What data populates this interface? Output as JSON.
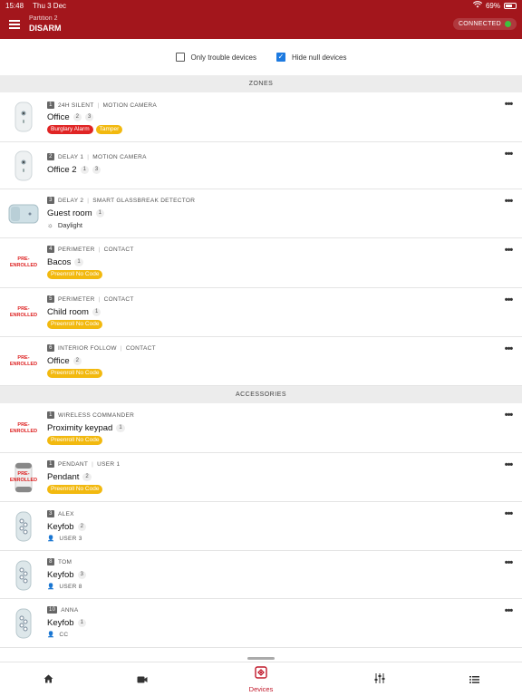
{
  "status_bar": {
    "time": "15:48",
    "date": "Thu 3 Dec",
    "battery": "69%"
  },
  "header": {
    "partition": "Partition 2",
    "state": "DISARM",
    "connection": "CONNECTED"
  },
  "filters": {
    "only_trouble": {
      "label": "Only trouble devices",
      "checked": false
    },
    "hide_null": {
      "label": "Hide null devices",
      "checked": true
    }
  },
  "sections": {
    "zones": "ZONES",
    "accessories": "ACCESSORIES"
  },
  "zones": [
    {
      "num": "1",
      "type": "24H SILENT",
      "model": "MOTION CAMERA",
      "name": "Office",
      "pills": [
        "2",
        "3"
      ],
      "tags": [
        "Burglary Alarm",
        "Tamper"
      ],
      "sub": ""
    },
    {
      "num": "2",
      "type": "DELAY 1",
      "model": "MOTION CAMERA",
      "name": "Office 2",
      "pills": [
        "1",
        "3"
      ],
      "tags": [],
      "sub": ""
    },
    {
      "num": "3",
      "type": "DELAY 2",
      "model": "SMART GLASSBREAK DETECTOR",
      "name": "Guest room",
      "pills": [
        "1"
      ],
      "tags": [],
      "sub": "Daylight"
    },
    {
      "num": "4",
      "type": "PERIMETER",
      "model": "CONTACT",
      "name": "Bacos",
      "pills": [
        "1"
      ],
      "tags": [
        "Preenroll No Code"
      ],
      "sub": ""
    },
    {
      "num": "5",
      "type": "PERIMETER",
      "model": "CONTACT",
      "name": "Child room",
      "pills": [
        "1"
      ],
      "tags": [
        "Preenroll No Code"
      ],
      "sub": ""
    },
    {
      "num": "6",
      "type": "INTERIOR FOLLOW",
      "model": "CONTACT",
      "name": "Office",
      "pills": [
        "2"
      ],
      "tags": [
        "Preenroll No Code"
      ],
      "sub": ""
    }
  ],
  "accessories": [
    {
      "num": "1",
      "type": "WIRELESS COMMANDER",
      "name": "Proximity keypad",
      "pills": [
        "1"
      ],
      "tag": "Preenroll No Code"
    },
    {
      "num": "1",
      "type": "PENDANT",
      "model": "USER 1",
      "name": "Pendant",
      "pills": [
        "2"
      ],
      "tag": "Preenroll No Code"
    },
    {
      "num": "3",
      "type": "ALEX",
      "name": "Keyfob",
      "pills": [
        "2"
      ],
      "user": "USER 3"
    },
    {
      "num": "8",
      "type": "TOM",
      "name": "Keyfob",
      "pills": [
        "3"
      ],
      "user": "USER 8"
    },
    {
      "num": "10",
      "type": "ANNA",
      "name": "Keyfob",
      "pills": [
        "1"
      ],
      "user": "CC"
    }
  ],
  "pre_enrolled_label": [
    "PRE-",
    "ENROLLED"
  ],
  "nav": {
    "devices_label": "Devices"
  },
  "colors": {
    "header": "#a3161c",
    "active": "#c0182a",
    "alarm": "#e02424",
    "warning": "#f2b90f",
    "connected": "#3ec23e"
  }
}
